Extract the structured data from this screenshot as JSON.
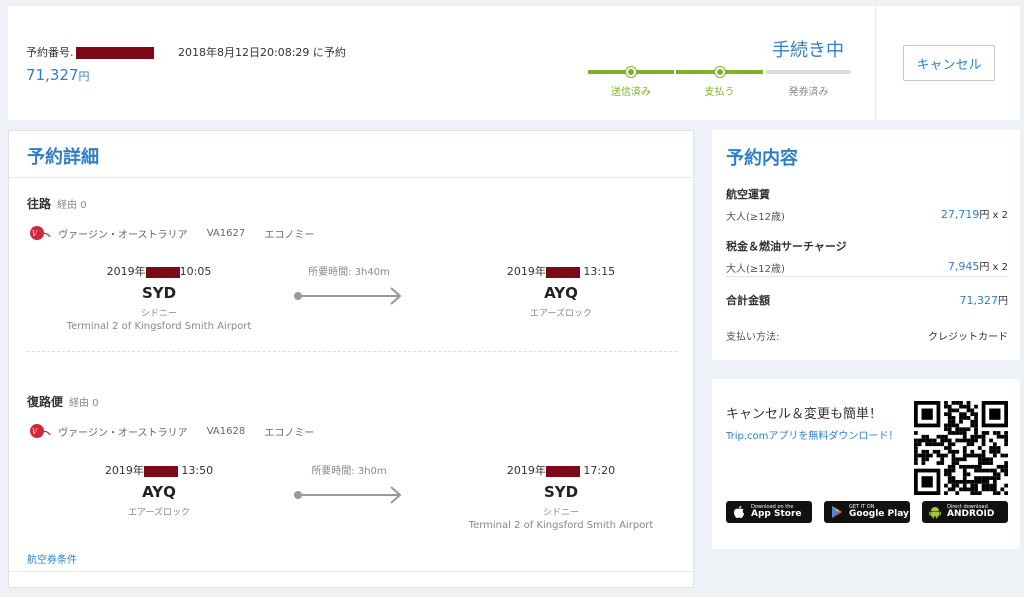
{
  "status": {
    "booking_number_label": "予約番号.",
    "booking_time": "2018年8月12日20:08:29 に予約",
    "total_price": "71,327",
    "currency": "円",
    "status_title": "手続き中",
    "steps": [
      {
        "label": "送信済み",
        "state": "done"
      },
      {
        "label": "支払う",
        "state": "done"
      },
      {
        "label": "発券済み",
        "state": "pending"
      }
    ],
    "cancel_label": "キャンセル"
  },
  "detail": {
    "title": "予約詳細",
    "outbound": {
      "label": "往路",
      "stops": "経由 0",
      "airline": "ヴァージン・オーストラリア",
      "flight_no": "VA1627",
      "cabin": "エコノミー",
      "dep_date_prefix": "2019年",
      "dep_time": "10:05",
      "dep_code": "SYD",
      "dep_city": "シドニー",
      "dep_terminal": "Terminal 2 of Kingsford Smith Airport",
      "duration": "所要時間: 3h40m",
      "arr_date_prefix": "2019年",
      "arr_time": "13:15",
      "arr_code": "AYQ",
      "arr_city": "エアーズロック"
    },
    "return": {
      "label": "復路便",
      "stops": "経由 0",
      "airline": "ヴァージン・オーストラリア",
      "flight_no": "VA1628",
      "cabin": "エコノミー",
      "dep_date_prefix": "2019年",
      "dep_time": "13:50",
      "dep_code": "AYQ",
      "dep_city": "エアーズロック",
      "duration": "所要時間: 3h0m",
      "arr_date_prefix": "2019年",
      "arr_time": "17:20",
      "arr_code": "SYD",
      "arr_city": "シドニー",
      "arr_terminal": "Terminal 2 of Kingsford Smith Airport"
    },
    "conditions_link": "航空券条件"
  },
  "summary": {
    "title": "予約内容",
    "fare_label": "航空運賃",
    "fare_sub": "大人(≥12歳)",
    "fare_amount": "27,719",
    "fare_unit": "円",
    "fare_qty": "x 2",
    "tax_label": "税金＆燃油サーチャージ",
    "tax_sub": "大人(≥12歳)",
    "tax_amount": "7,945",
    "tax_unit": "円",
    "tax_qty": "x 2",
    "total_label": "合計金額",
    "total_amount": "71,327",
    "total_unit": "円",
    "payment_label": "支払い方法:",
    "payment_value": "クレジットカード"
  },
  "promo": {
    "headline": "キャンセル＆変更も簡単！",
    "subline": "Trip.comアプリを無料ダウンロード！",
    "appstore_top": "Download on the",
    "appstore_main": "App Store",
    "googleplay_top": "GET IT ON",
    "googleplay_main": "Google Play",
    "android_top": "Direct download",
    "android_main": "ANDROID"
  },
  "colors": {
    "accent": "#2e7fc8",
    "step_done": "#7fb02c",
    "step_pending": "#dddddd",
    "redaction": "#7b0a16"
  }
}
